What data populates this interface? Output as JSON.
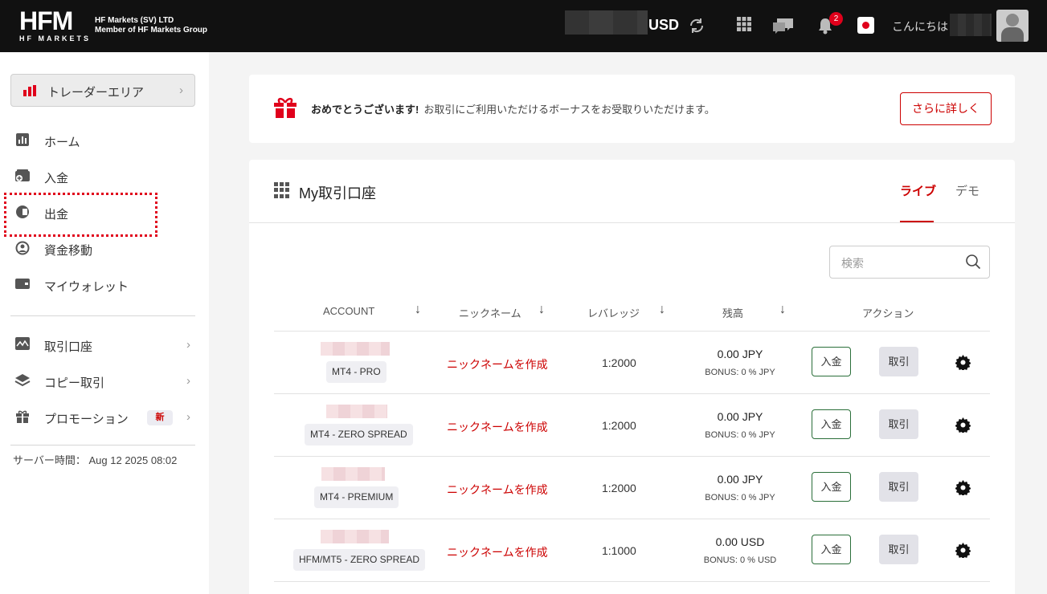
{
  "header": {
    "logo_text": "HFM",
    "logo_sub": "HF MARKETS",
    "company_line1": "HF Markets (SV) LTD",
    "company_line2": "Member of HF Markets Group",
    "currency": "USD",
    "notification_count": "2",
    "greeting": "こんにちは",
    "icons": [
      "refresh-icon",
      "apps-grid-icon",
      "chat-icon",
      "bell-icon",
      "japan-flag-icon",
      "avatar"
    ]
  },
  "sidebar": {
    "trader_area": "トレーダーエリア",
    "items": [
      {
        "label": "ホーム",
        "icon": "chart-icon"
      },
      {
        "label": "入金",
        "icon": "wallet-plus-icon"
      },
      {
        "label": "出金",
        "icon": "withdraw-icon"
      },
      {
        "label": "資金移動",
        "icon": "transfer-icon"
      },
      {
        "label": "マイウォレット",
        "icon": "wallet-icon"
      }
    ],
    "group_items": [
      {
        "label": "取引口座",
        "icon": "trading-chart-icon"
      },
      {
        "label": "コピー取引",
        "icon": "layers-icon"
      },
      {
        "label": "プロモーション",
        "icon": "gift-icon",
        "badge": "新"
      }
    ],
    "server_time_label": "サーバー時間：",
    "server_time": "Aug 12 2025 08:02"
  },
  "banner": {
    "title": "おめでとうございます!",
    "message": "お取引にご利用いただけるボーナスをお受取りいただけます。",
    "button": "さらに詳しく"
  },
  "accounts": {
    "title": "My取引口座",
    "tabs": {
      "live": "ライブ",
      "demo": "デモ"
    },
    "search_placeholder": "検索",
    "columns": {
      "account": "ACCOUNT",
      "nickname": "ニックネーム",
      "leverage": "レバレッジ",
      "balance": "残高",
      "action": "アクション"
    },
    "rows": [
      {
        "type": "MT4 - PRO",
        "nickname": "ニックネームを作成",
        "leverage": "1:2000",
        "balance": "0.00 JPY",
        "bonus": "BONUS: 0 % JPY",
        "deposit": "入金",
        "trade": "取引"
      },
      {
        "type": "MT4 - ZERO SPREAD",
        "nickname": "ニックネームを作成",
        "leverage": "1:2000",
        "balance": "0.00 JPY",
        "bonus": "BONUS: 0 % JPY",
        "deposit": "入金",
        "trade": "取引"
      },
      {
        "type": "MT4 - PREMIUM",
        "nickname": "ニックネームを作成",
        "leverage": "1:2000",
        "balance": "0.00 JPY",
        "bonus": "BONUS: 0 % JPY",
        "deposit": "入金",
        "trade": "取引"
      },
      {
        "type": "HFM/MT5 - ZERO SPREAD",
        "nickname": "ニックネームを作成",
        "leverage": "1:1000",
        "balance": "0.00 USD",
        "bonus": "BONUS: 0 % USD",
        "deposit": "入金",
        "trade": "取引"
      }
    ]
  },
  "colors": {
    "accent": "#e0001b",
    "header_bg": "#111111",
    "deposit_border": "#2b6f3a"
  }
}
